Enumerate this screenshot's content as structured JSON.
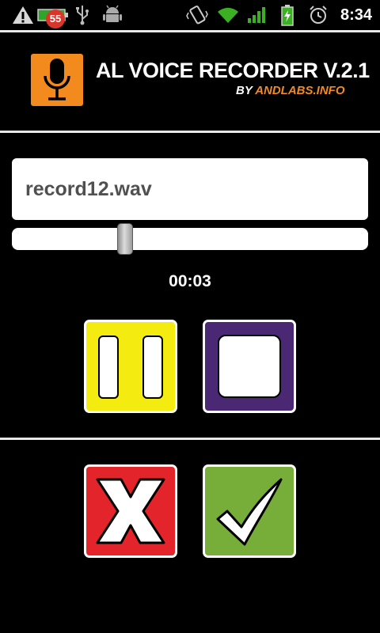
{
  "status_bar": {
    "notification_count": "55",
    "time": "8:34",
    "icons": [
      "warning-icon",
      "battery-notification-icon",
      "usb-icon",
      "android-debug-icon",
      "vibrate-icon",
      "wifi-icon",
      "signal-icon",
      "battery-charging-icon",
      "alarm-icon"
    ]
  },
  "header": {
    "title": "AL VOICE RECORDER V.2.1",
    "by": "BY ",
    "site": "ANDLABS.INFO",
    "logo_icon": "microphone-icon"
  },
  "recorder": {
    "filename": "record12.wav",
    "elapsed": "00:03",
    "seek_fraction": 0.31
  },
  "controls": {
    "pause_icon": "pause-icon",
    "stop_icon": "stop-icon",
    "cancel_icon": "x-icon",
    "confirm_icon": "checkmark-icon"
  },
  "colors": {
    "accent_orange": "#f28a1e",
    "pause_yellow": "#f4ec10",
    "stop_purple": "#4a2873",
    "cancel_red": "#e3242b",
    "confirm_green": "#77ae3a"
  }
}
